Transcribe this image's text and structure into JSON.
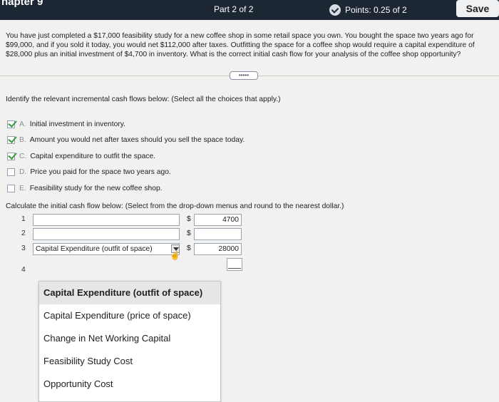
{
  "header": {
    "chapter": "hapter 9",
    "part": "Part 2 of 2",
    "points": "Points: 0.25 of 2",
    "save_label": "Save"
  },
  "problem_text": "You have just completed a $17,000 feasibility study for a new coffee shop in some retail space you own. You bought the space two years ago for $99,000, and if you sold it today, you would net $112,000 after taxes. Outfitting the space for a coffee shop would require a capital expenditure of $28,000 plus an initial investment of $4,700 in inventory. What is the correct initial cash flow for your analysis of the coffee shop opportunity?",
  "expand_label": "•••••",
  "instruction": "Identify the relevant incremental cash flows below: (Select all the choices that apply.)",
  "choices": [
    {
      "letter": "A.",
      "text": "Initial investment in inventory.",
      "checked": true
    },
    {
      "letter": "B.",
      "text": "Amount you would net after taxes should you sell the space today.",
      "checked": true
    },
    {
      "letter": "C.",
      "text": "Capital expenditure to outfit the space.",
      "checked": true
    },
    {
      "letter": "D.",
      "text": "Price you paid for the space two years ago.",
      "checked": false
    },
    {
      "letter": "E.",
      "text": "Feasibility study for the new coffee shop.",
      "checked": false
    }
  ],
  "calc_instruction": "Calculate the initial cash flow below: (Select from the drop-down menus and round to the nearest dollar.)",
  "rows": [
    {
      "num": "1",
      "selection": "",
      "dollar": "$",
      "amount": "4700"
    },
    {
      "num": "2",
      "selection": "",
      "dollar": "$",
      "amount": ""
    },
    {
      "num": "3",
      "selection": "Capital Expenditure (outfit of space)",
      "dollar": "$",
      "amount": "28000"
    },
    {
      "num": "4",
      "selection": "",
      "dollar": "",
      "amount": ""
    }
  ],
  "dropdown_options": [
    "Capital Expenditure (outfit of space)",
    "Capital Expenditure (price of space)",
    "Change in Net Working Capital",
    "Feasibility Study Cost",
    "Opportunity Cost"
  ],
  "dropdown_selected": "Capital Expenditure (outfit of space)"
}
